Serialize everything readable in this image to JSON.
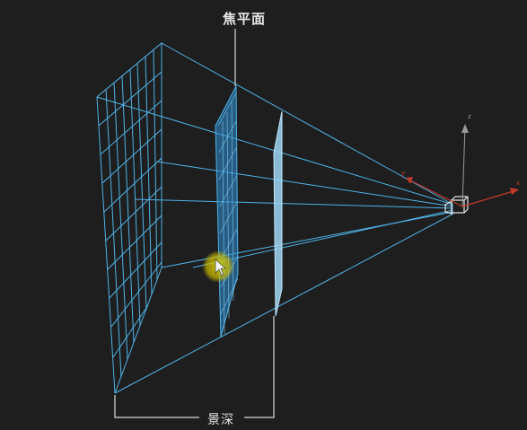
{
  "labels": {
    "focal_plane": "焦平面",
    "depth_of_field": "景深"
  },
  "axes": {
    "x": "x",
    "y": "y",
    "z": "z"
  },
  "colors": {
    "background": "#1e1e1e",
    "frustum": "#4fb3e8",
    "focal_plane": "#2f8fd6",
    "dof_plane": "#9fd7f5",
    "axis_red": "#c0392b",
    "axis_gray": "#9a9a9a",
    "cursor_highlight": "#d8c800"
  }
}
